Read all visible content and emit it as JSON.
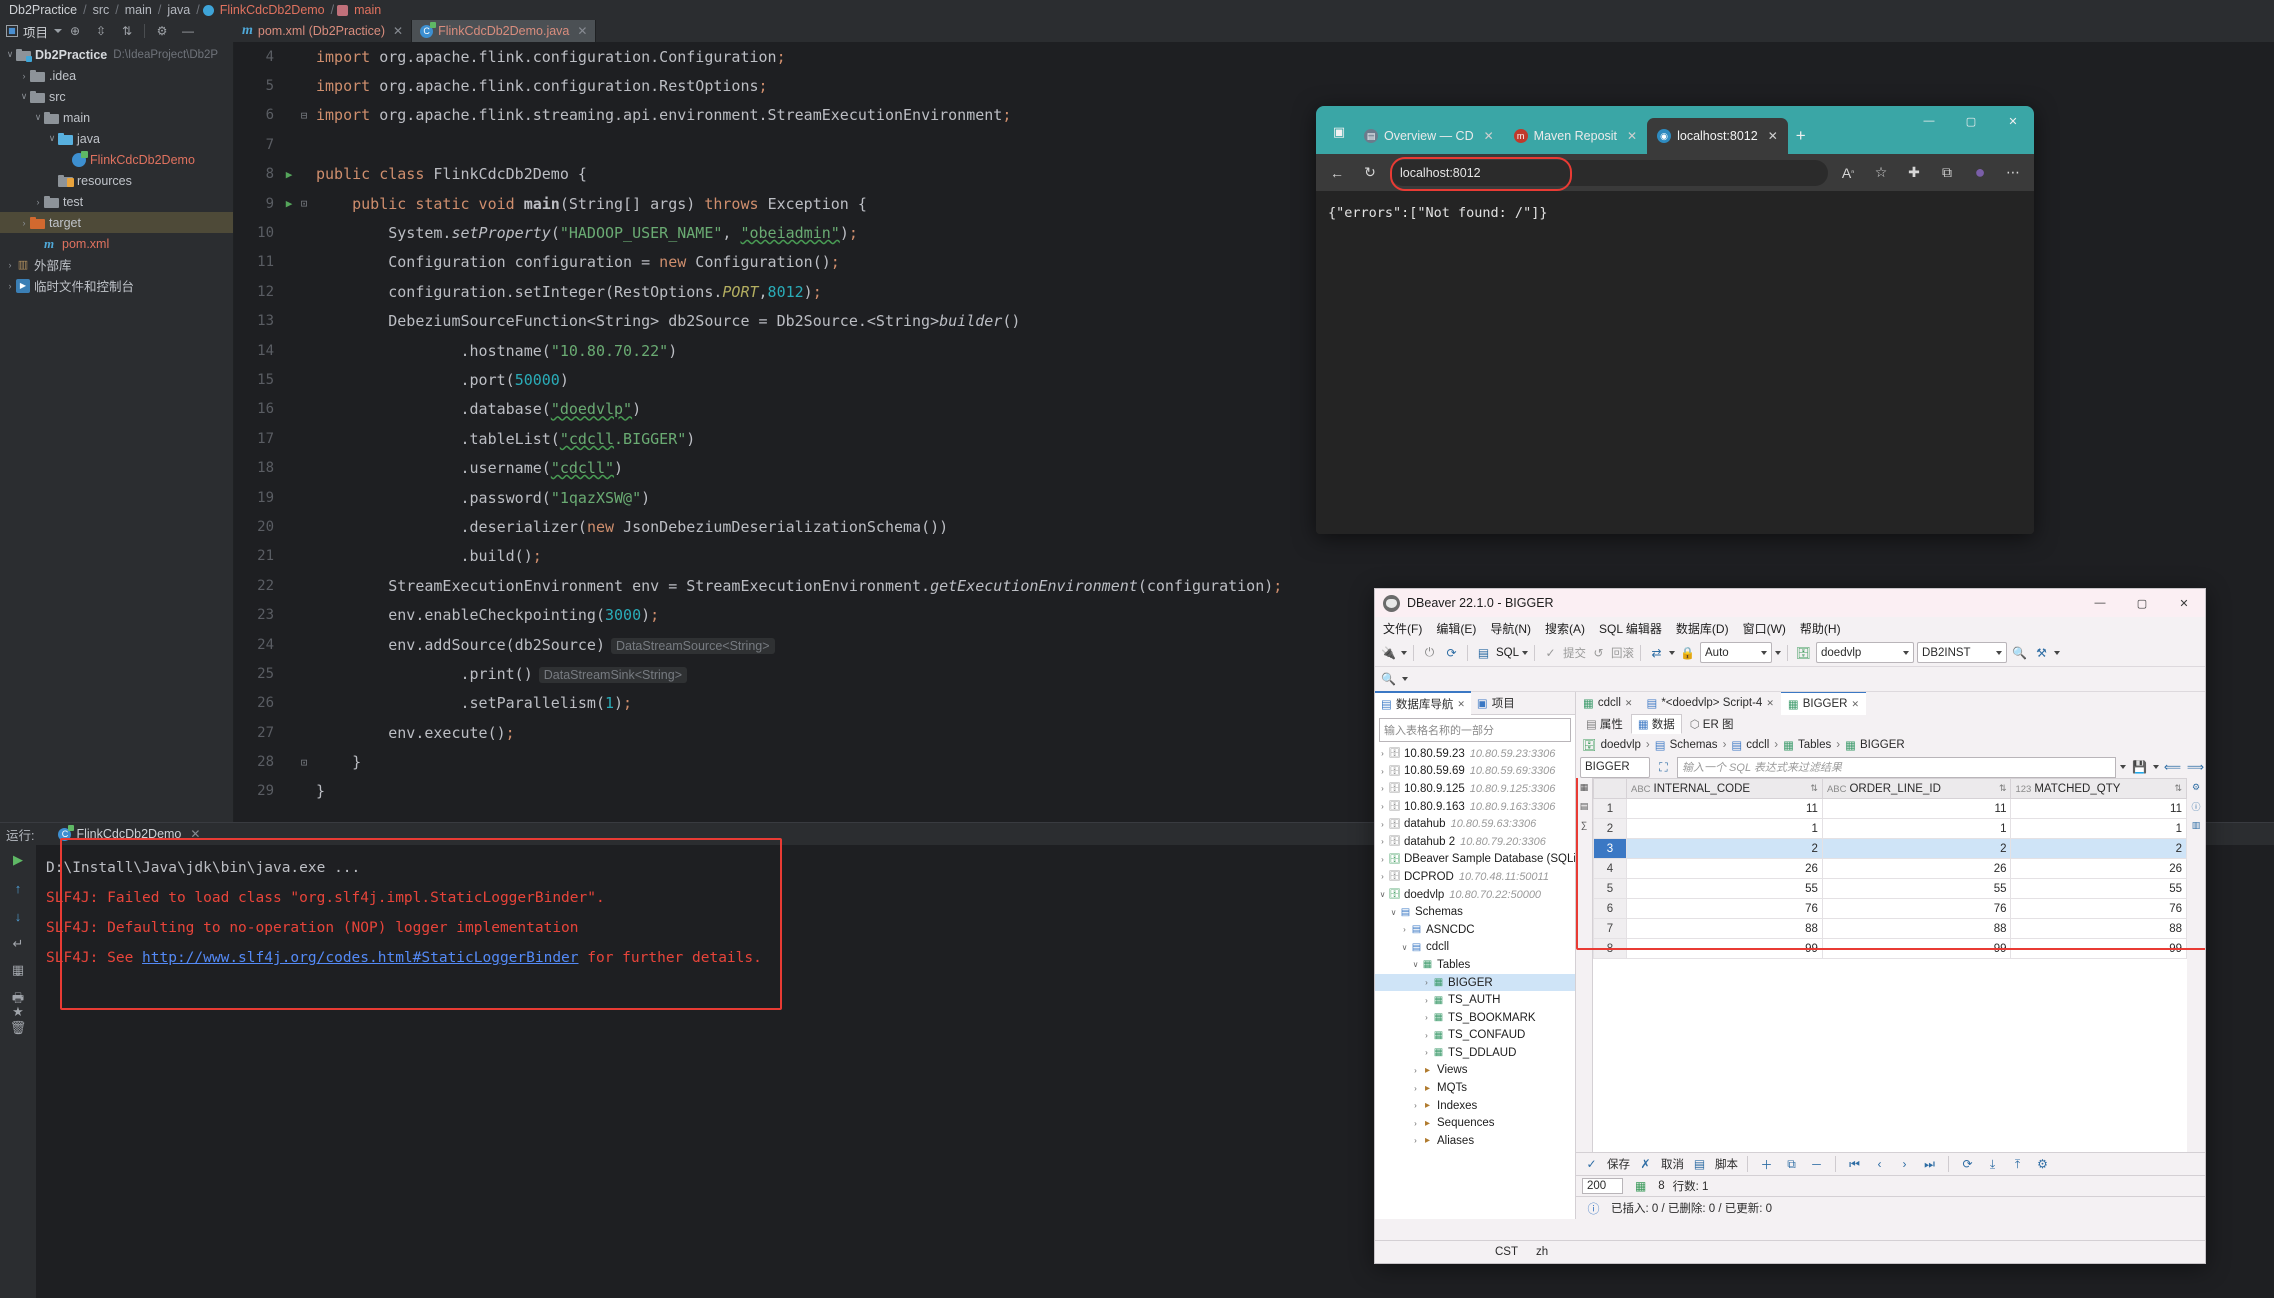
{
  "ide": {
    "breadcrumb": [
      "Db2Practice",
      "src",
      "main",
      "java",
      "FlinkCdcDb2Demo",
      "main"
    ],
    "toolbar": {
      "project_label": "项目",
      "icons": [
        "locate-icon",
        "expand-all-icon",
        "collapse-all-icon",
        "settings-icon",
        "hide-icon"
      ]
    },
    "tabs": [
      {
        "label": "pom.xml (Db2Practice)",
        "icon": "maven-icon",
        "active": false
      },
      {
        "label": "FlinkCdcDb2Demo.java",
        "icon": "java-class-icon",
        "active": true
      }
    ],
    "tree": [
      {
        "indent": 0,
        "arrow": "v",
        "icon": "module-icon",
        "label": "Db2Practice",
        "path": "D:\\IdeaProject\\Db2P",
        "bold": true
      },
      {
        "indent": 1,
        "arrow": ">",
        "icon": "folder-icon",
        "label": ".idea"
      },
      {
        "indent": 1,
        "arrow": "v",
        "icon": "folder-icon",
        "label": "src"
      },
      {
        "indent": 2,
        "arrow": "v",
        "icon": "folder-icon",
        "label": "main"
      },
      {
        "indent": 3,
        "arrow": "v",
        "icon": "source-folder-icon",
        "label": "java"
      },
      {
        "indent": 4,
        "arrow": "",
        "icon": "java-class-icon",
        "label": "FlinkCdcDb2Demo",
        "red": true
      },
      {
        "indent": 3,
        "arrow": "",
        "icon": "resources-folder-icon",
        "label": "resources"
      },
      {
        "indent": 2,
        "arrow": ">",
        "icon": "folder-icon",
        "label": "test"
      },
      {
        "indent": 1,
        "arrow": ">",
        "icon": "target-folder-icon",
        "label": "target",
        "selected": true
      },
      {
        "indent": 2,
        "arrow": "",
        "icon": "maven-icon",
        "label": "pom.xml",
        "red": true
      },
      {
        "indent": 0,
        "arrow": ">",
        "icon": "library-icon",
        "label": "外部库"
      },
      {
        "indent": 0,
        "arrow": ">",
        "icon": "scratch-icon",
        "label": "临时文件和控制台"
      }
    ],
    "code": [
      {
        "n": 4,
        "run": false,
        "fold": "",
        "tokens": [
          [
            "kw",
            "import"
          ],
          [
            "pl",
            " org.apache.flink.configuration.Configuration"
          ],
          [
            "semi",
            ";"
          ]
        ]
      },
      {
        "n": 5,
        "run": false,
        "fold": "",
        "tokens": [
          [
            "kw",
            "import"
          ],
          [
            "pl",
            " org.apache.flink.configuration.RestOptions"
          ],
          [
            "semi",
            ";"
          ]
        ]
      },
      {
        "n": 6,
        "run": false,
        "fold": "-",
        "tokens": [
          [
            "kw",
            "import"
          ],
          [
            "pl",
            " org.apache.flink.streaming.api.environment.StreamExecutionEnvironment"
          ],
          [
            "semi",
            ";"
          ]
        ]
      },
      {
        "n": 7,
        "run": false,
        "fold": "",
        "tokens": []
      },
      {
        "n": 8,
        "run": true,
        "fold": "",
        "tokens": [
          [
            "kw",
            "public class "
          ],
          [
            "pl",
            "FlinkCdcDb2Demo {"
          ]
        ]
      },
      {
        "n": 9,
        "run": true,
        "fold": "o",
        "tokens": [
          [
            "pl",
            "    "
          ],
          [
            "kw",
            "public static void "
          ],
          [
            "fnb",
            "main"
          ],
          [
            "pl",
            "(String[] args) "
          ],
          [
            "kw",
            "throws "
          ],
          [
            "pl",
            "Exception {"
          ]
        ]
      },
      {
        "n": 10,
        "run": false,
        "fold": "",
        "tokens": [
          [
            "pl",
            "        System."
          ],
          [
            "fn",
            "setProperty"
          ],
          [
            "pl",
            "("
          ],
          [
            "str",
            "\"HADOOP_USER_NAME\""
          ],
          [
            "pl",
            ", "
          ],
          [
            "strw",
            "\"obeiadmin\""
          ],
          [
            "pl",
            ")"
          ],
          [
            "semi",
            ";"
          ]
        ]
      },
      {
        "n": 11,
        "run": false,
        "fold": "",
        "tokens": [
          [
            "pl",
            "        Configuration configuration = "
          ],
          [
            "kw",
            "new "
          ],
          [
            "pl",
            "Configuration()"
          ],
          [
            "semi",
            ";"
          ]
        ]
      },
      {
        "n": 12,
        "run": false,
        "fold": "",
        "tokens": [
          [
            "pl",
            "        configuration.setInteger(RestOptions."
          ],
          [
            "stat",
            "PORT"
          ],
          [
            "pl",
            ","
          ],
          [
            "num",
            "8012"
          ],
          [
            "pl",
            ")"
          ],
          [
            "semi",
            ";"
          ]
        ]
      },
      {
        "n": 13,
        "run": false,
        "fold": "",
        "tokens": [
          [
            "pl",
            "        DebeziumSourceFunction<String> db2Source = Db2Source.<String>"
          ],
          [
            "fn",
            "builder"
          ],
          [
            "pl",
            "()"
          ]
        ]
      },
      {
        "n": 14,
        "run": false,
        "fold": "",
        "tokens": [
          [
            "pl",
            "                .hostname("
          ],
          [
            "str",
            "\"10.80.70.22\""
          ],
          [
            "pl",
            ")"
          ]
        ]
      },
      {
        "n": 15,
        "run": false,
        "fold": "",
        "tokens": [
          [
            "pl",
            "                .port("
          ],
          [
            "num",
            "50000"
          ],
          [
            "pl",
            ")"
          ]
        ]
      },
      {
        "n": 16,
        "run": false,
        "fold": "",
        "tokens": [
          [
            "pl",
            "                .database("
          ],
          [
            "strw",
            "\"doedvlp\""
          ],
          [
            "pl",
            ")"
          ]
        ]
      },
      {
        "n": 17,
        "run": false,
        "fold": "",
        "tokens": [
          [
            "pl",
            "                .tableList("
          ],
          [
            "strw",
            "\"cdcll"
          ],
          [
            "str",
            ".BIGGER\""
          ],
          [
            "pl",
            ")"
          ]
        ]
      },
      {
        "n": 18,
        "run": false,
        "fold": "",
        "tokens": [
          [
            "pl",
            "                .username("
          ],
          [
            "strw",
            "\"cdcll\""
          ],
          [
            "pl",
            ")"
          ]
        ]
      },
      {
        "n": 19,
        "run": false,
        "fold": "",
        "tokens": [
          [
            "pl",
            "                .password("
          ],
          [
            "str",
            "\"1qazXSW@\""
          ],
          [
            "pl",
            ")"
          ]
        ]
      },
      {
        "n": 20,
        "run": false,
        "fold": "",
        "tokens": [
          [
            "pl",
            "                .deserializer("
          ],
          [
            "kw",
            "new "
          ],
          [
            "pl",
            "JsonDebeziumDeserializationSchema())"
          ]
        ]
      },
      {
        "n": 21,
        "run": false,
        "fold": "",
        "tokens": [
          [
            "pl",
            "                .build()"
          ],
          [
            "semi",
            ";"
          ]
        ]
      },
      {
        "n": 22,
        "run": false,
        "fold": "",
        "tokens": [
          [
            "pl",
            "        StreamExecutionEnvironment env = StreamExecutionEnvironment."
          ],
          [
            "fn",
            "getExecutionEnvironment"
          ],
          [
            "pl",
            "(configuration)"
          ],
          [
            "semi",
            ";"
          ]
        ]
      },
      {
        "n": 23,
        "run": false,
        "fold": "",
        "tokens": [
          [
            "pl",
            "        env.enableCheckpointing("
          ],
          [
            "num",
            "3000"
          ],
          [
            "pl",
            ")"
          ],
          [
            "semi",
            ";"
          ]
        ]
      },
      {
        "n": 24,
        "run": false,
        "fold": "",
        "tokens": [
          [
            "pl",
            "        env.addSource(db2Source)"
          ],
          [
            "hint",
            "DataStreamSource<String>"
          ]
        ]
      },
      {
        "n": 25,
        "run": false,
        "fold": "",
        "tokens": [
          [
            "pl",
            "                .print()"
          ],
          [
            "hint",
            "DataStreamSink<String>"
          ]
        ]
      },
      {
        "n": 26,
        "run": false,
        "fold": "",
        "tokens": [
          [
            "pl",
            "                .setParallelism("
          ],
          [
            "num",
            "1"
          ],
          [
            "pl",
            ")"
          ],
          [
            "semi",
            ";"
          ]
        ]
      },
      {
        "n": 27,
        "run": false,
        "fold": "",
        "tokens": [
          [
            "pl",
            "        env.execute()"
          ],
          [
            "semi",
            ";"
          ]
        ]
      },
      {
        "n": 28,
        "run": false,
        "fold": "o",
        "tokens": [
          [
            "pl",
            "    }"
          ]
        ]
      },
      {
        "n": 29,
        "run": false,
        "fold": "",
        "tokens": [
          [
            "pl",
            "}"
          ]
        ]
      }
    ],
    "console": {
      "label": "运行:",
      "run_tab": "FlinkCdcDb2Demo",
      "lines": [
        {
          "text": "D:\\Install\\Java\\jdk\\bin\\java.exe ...",
          "color": "#bcbec4"
        },
        {
          "text": "SLF4J: Failed to load class \"org.slf4j.impl.StaticLoggerBinder\".",
          "color": "#e8443a"
        },
        {
          "text": "SLF4J: Defaulting to no-operation (NOP) logger implementation",
          "color": "#e8443a"
        },
        {
          "prefix": "SLF4J: See ",
          "link": "http://www.slf4j.org/codes.html#StaticLoggerBinder",
          "suffix": " for further details.",
          "color": "#e8443a"
        }
      ]
    }
  },
  "browser": {
    "tabs": [
      {
        "label": "Overview — CD",
        "favicon": "doc-icon",
        "active": false
      },
      {
        "label": "Maven Reposit",
        "favicon": "maven-icon",
        "active": false
      },
      {
        "label": "localhost:8012",
        "favicon": "globe-icon",
        "active": true
      }
    ],
    "new_tab_label": "+",
    "window_buttons": [
      "minimize",
      "maximize",
      "close"
    ],
    "nav": {
      "back": "←",
      "reload": "↻"
    },
    "url": "localhost:8012",
    "omnibox_icons": [
      "read-aloud-icon",
      "favorites-icon",
      "collections-icon",
      "profile-icon",
      "settings-menu-icon"
    ],
    "page_content": "{\"errors\":[\"Not found: /\"]}"
  },
  "dbeaver": {
    "title": "DBeaver 22.1.0 - BIGGER",
    "menus": [
      "文件(F)",
      "编辑(E)",
      "导航(N)",
      "搜索(A)",
      "SQL 编辑器",
      "数据库(D)",
      "窗口(W)",
      "帮助(H)"
    ],
    "toolbar": {
      "commit_label": "提交",
      "rollback_label": "回滚",
      "sql_label": "SQL",
      "auto_label": "Auto",
      "connection": "doedvlp",
      "db_instance": "DB2INST"
    },
    "nav_tabs": [
      {
        "label": "数据库导航",
        "active": true
      },
      {
        "label": "项目",
        "active": false
      }
    ],
    "filter_placeholder": "输入表格名称的一部分",
    "nav_tree": [
      {
        "indent": 0,
        "arrow": ">",
        "icon": "db-icon",
        "label": "10.80.59.23",
        "note": "10.80.59.23:3306"
      },
      {
        "indent": 0,
        "arrow": ">",
        "icon": "db-icon",
        "label": "10.80.59.69",
        "note": "10.80.59.69:3306"
      },
      {
        "indent": 0,
        "arrow": ">",
        "icon": "db-icon",
        "label": "10.80.9.125",
        "note": "10.80.9.125:3306"
      },
      {
        "indent": 0,
        "arrow": ">",
        "icon": "db-icon",
        "label": "10.80.9.163",
        "note": "10.80.9.163:3306"
      },
      {
        "indent": 0,
        "arrow": ">",
        "icon": "db-icon",
        "label": "datahub",
        "note": "10.80.59.63:3306"
      },
      {
        "indent": 0,
        "arrow": ">",
        "icon": "db-icon",
        "label": "datahub 2",
        "note": "10.80.79.20:3306"
      },
      {
        "indent": 0,
        "arrow": ">",
        "icon": "db-sqlite-icon",
        "label": "DBeaver Sample Database (SQLite"
      },
      {
        "indent": 0,
        "arrow": ">",
        "icon": "db-icon",
        "label": "DCPROD",
        "note": "10.70.48.11:50011"
      },
      {
        "indent": 0,
        "arrow": "v",
        "icon": "db-icon-active",
        "label": "doedvlp",
        "note": "10.80.70.22:50000"
      },
      {
        "indent": 1,
        "arrow": "v",
        "icon": "schemas-icon",
        "label": "Schemas"
      },
      {
        "indent": 2,
        "arrow": ">",
        "icon": "schema-icon",
        "label": "ASNCDC"
      },
      {
        "indent": 2,
        "arrow": "v",
        "icon": "schema-icon",
        "label": "cdcll"
      },
      {
        "indent": 3,
        "arrow": "v",
        "icon": "tables-icon",
        "label": "Tables"
      },
      {
        "indent": 4,
        "arrow": ">",
        "icon": "table-icon",
        "label": "BIGGER",
        "selected": true
      },
      {
        "indent": 4,
        "arrow": ">",
        "icon": "table-icon",
        "label": "TS_AUTH"
      },
      {
        "indent": 4,
        "arrow": ">",
        "icon": "table-icon",
        "label": "TS_BOOKMARK"
      },
      {
        "indent": 4,
        "arrow": ">",
        "icon": "table-icon",
        "label": "TS_CONFAUD"
      },
      {
        "indent": 4,
        "arrow": ">",
        "icon": "table-icon",
        "label": "TS_DDLAUD"
      },
      {
        "indent": 3,
        "arrow": ">",
        "icon": "views-icon",
        "label": "Views"
      },
      {
        "indent": 3,
        "arrow": ">",
        "icon": "mqts-icon",
        "label": "MQTs"
      },
      {
        "indent": 3,
        "arrow": ">",
        "icon": "indexes-icon",
        "label": "Indexes"
      },
      {
        "indent": 3,
        "arrow": ">",
        "icon": "sequences-icon",
        "label": "Sequences"
      },
      {
        "indent": 3,
        "arrow": ">",
        "icon": "aliases-icon",
        "label": "Aliases"
      }
    ],
    "editor_tabs": [
      {
        "label": "cdcll",
        "active": false
      },
      {
        "label": "*<doedvlp> Script-4",
        "active": false
      },
      {
        "label": "BIGGER",
        "active": true
      }
    ],
    "sub_tabs": [
      {
        "label": "属性",
        "active": false
      },
      {
        "label": "数据",
        "active": true
      },
      {
        "label": "ER 图",
        "active": false
      }
    ],
    "breadcrumbs": [
      "doedvlp",
      "Schemas",
      "cdcll",
      "Tables",
      "BIGGER"
    ],
    "grid_label": "BIGGER",
    "sql_placeholder": "输入一个 SQL 表达式来过滤结果",
    "columns": [
      {
        "tag": "ABC",
        "name": "INTERNAL_CODE"
      },
      {
        "tag": "ABC",
        "name": "ORDER_LINE_ID"
      },
      {
        "tag": "123",
        "name": "MATCHED_QTY"
      }
    ],
    "rows": [
      {
        "n": 1,
        "cells": [
          "11",
          "11",
          "11"
        ],
        "selected": false
      },
      {
        "n": 2,
        "cells": [
          "1",
          "1",
          "1"
        ],
        "selected": false
      },
      {
        "n": 3,
        "cells": [
          "2",
          "2",
          "2"
        ],
        "selected": true
      },
      {
        "n": 4,
        "cells": [
          "26",
          "26",
          "26"
        ],
        "selected": false
      },
      {
        "n": 5,
        "cells": [
          "55",
          "55",
          "55"
        ],
        "selected": false
      },
      {
        "n": 6,
        "cells": [
          "76",
          "76",
          "76"
        ],
        "selected": false
      },
      {
        "n": 7,
        "cells": [
          "88",
          "88",
          "88"
        ],
        "selected": false
      },
      {
        "n": 8,
        "cells": [
          "99",
          "99",
          "99"
        ],
        "selected": false
      }
    ],
    "grid_footer": {
      "save_label": "保存",
      "cancel_label": "取消",
      "script_label": "脚本"
    },
    "fetch_size": "200",
    "row_count_label": "8",
    "rows_label": "行数: 1",
    "status_text": "已插入: 0 / 已删除: 0 / 已更新: 0",
    "footer": {
      "encoding": "CST",
      "lang": "zh"
    }
  }
}
